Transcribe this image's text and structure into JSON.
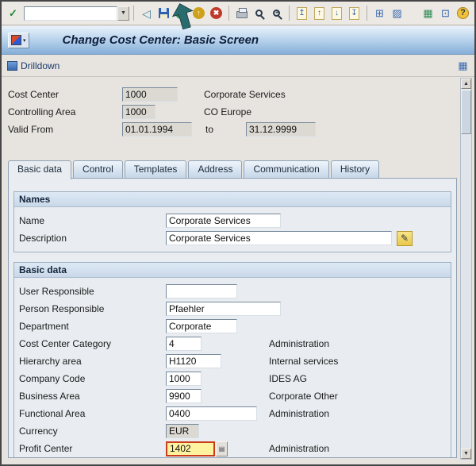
{
  "titlebar": {
    "title": "Change Cost Center: Basic Screen",
    "menu_arrow": "▾"
  },
  "toolbar": {
    "command_value": "",
    "icons": {
      "enter": "✓",
      "combo_arrow": "▼",
      "nav_back": "◁",
      "circle_back": "←",
      "circle_exit": "↑",
      "cancel": "✖",
      "find_plus": "+",
      "page_first": "↥",
      "page_prev": "↑",
      "page_next": "↓",
      "page_last": "↧",
      "session_new": "⊞",
      "shortcut": "▨",
      "customize": "▦",
      "new_window": "⊡",
      "help": "?",
      "scroll_up": "▲",
      "scroll_down": "▼",
      "pencil": "✎",
      "combo_lines": "▤"
    }
  },
  "app_toolbar": {
    "drilldown": "Drilldown"
  },
  "header": {
    "rows": [
      {
        "label": "Cost Center",
        "value": "1000",
        "text": "Corporate Services"
      },
      {
        "label": "Controlling Area",
        "value": "1000",
        "text": "CO Europe"
      },
      {
        "label": "Valid From",
        "value": "01.01.1994",
        "to_label": "to",
        "to_value": "31.12.9999"
      }
    ]
  },
  "tabs": [
    {
      "label": "Basic data"
    },
    {
      "label": "Control"
    },
    {
      "label": "Templates"
    },
    {
      "label": "Address"
    },
    {
      "label": "Communication"
    },
    {
      "label": "History"
    }
  ],
  "names": {
    "title": "Names",
    "rows": [
      {
        "label": "Name",
        "value": "Corporate Services"
      },
      {
        "label": "Description",
        "value": "Corporate Services"
      }
    ]
  },
  "basic": {
    "title": "Basic data",
    "rows": [
      {
        "label": "User Responsible",
        "value": "",
        "desc": ""
      },
      {
        "label": "Person Responsible",
        "value": "Pfaehler",
        "desc": ""
      },
      {
        "label": "Department",
        "value": "Corporate",
        "desc": ""
      },
      {
        "label": "Cost Center Category",
        "value": "4",
        "desc": "Administration"
      },
      {
        "label": "Hierarchy area",
        "value": "H1120",
        "desc": "Internal services"
      },
      {
        "label": "Company Code",
        "value": "1000",
        "desc": "IDES AG"
      },
      {
        "label": "Business Area",
        "value": "9900",
        "desc": "Corporate Other"
      },
      {
        "label": "Functional Area",
        "value": "0400",
        "desc": "Administration"
      },
      {
        "label": "Currency",
        "value": "EUR",
        "desc": ""
      },
      {
        "label": "Profit Center",
        "value": "1402",
        "desc": "Administration"
      }
    ]
  },
  "colors": {
    "annotation_arrow": "#2a6b6e",
    "focus_field_bg": "#fff3a0",
    "focus_field_border": "#cc3b1e",
    "titlebar_blue": "#85aed8"
  }
}
